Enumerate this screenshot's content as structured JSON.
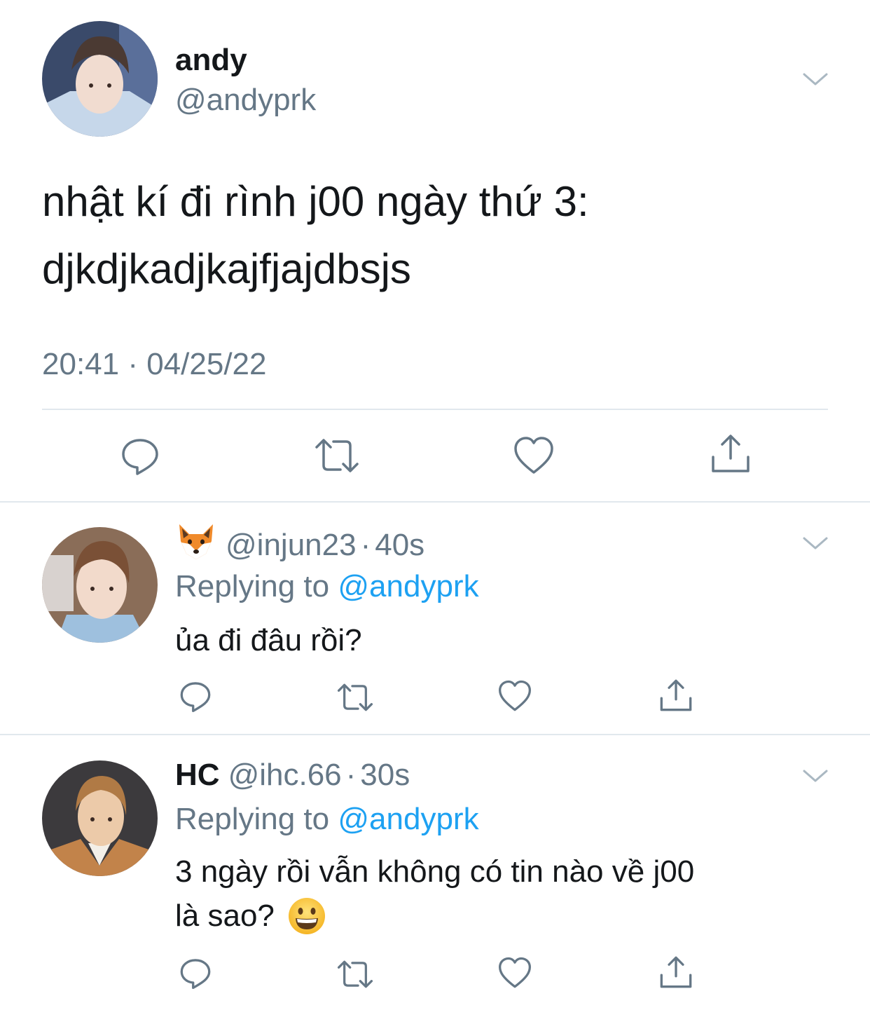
{
  "main_tweet": {
    "display_name": "andy",
    "handle": "@andyprk",
    "text_line1": "nhật kí đi rình j00 ngày thứ 3:",
    "text_line2": "djkdjkadjkajfjajdbsjs",
    "timestamp": "20:41 · 04/25/22"
  },
  "replies": [
    {
      "display_emoji": "fox-face-emoji",
      "handle": "@injun23",
      "separator": "·",
      "time": "40s",
      "replying_prefix": "Replying to",
      "replying_to": "@andyprk",
      "text_line1": "ủa đi đâu rồi?",
      "text_line2": ""
    },
    {
      "display_name": "HC",
      "handle": "@ihc.66",
      "separator": "·",
      "time": "30s",
      "replying_prefix": "Replying to",
      "replying_to": "@andyprk",
      "text_line1": "3 ngày rồi vẫn không có tin nào về j00",
      "text_line2": "là sao?",
      "trailing_emoji": "grinning-face-emoji"
    }
  ],
  "colors": {
    "text_primary": "#14171a",
    "text_secondary": "#657786",
    "link": "#1da1f2",
    "icon": "#657786",
    "divider": "#e1e8ed"
  },
  "icons": {
    "reply": "reply-icon",
    "retweet": "retweet-icon",
    "like": "heart-icon",
    "share": "share-icon",
    "menu": "chevron-down-icon"
  }
}
